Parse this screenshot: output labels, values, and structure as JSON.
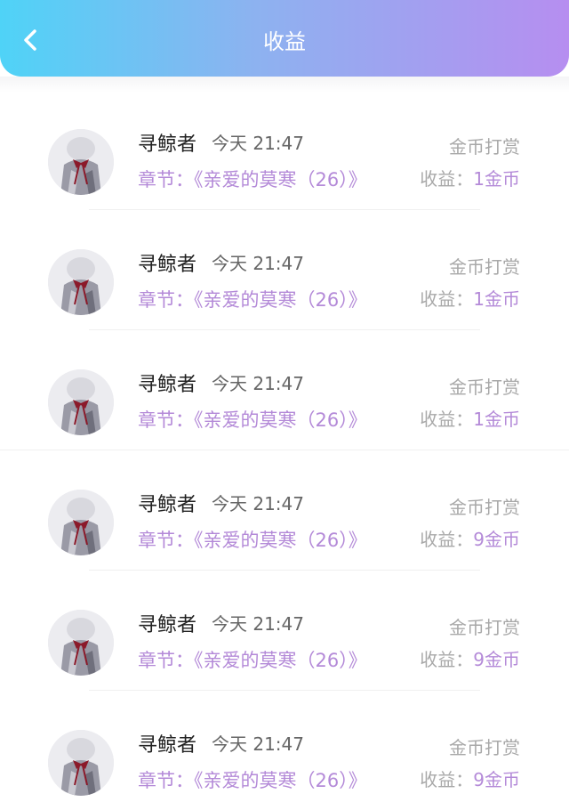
{
  "header": {
    "title": "收益",
    "back_icon": "chevron-left-icon"
  },
  "colors": {
    "accent": "#b48ad8",
    "gradient_start": "#4fd3f7",
    "gradient_end": "#b68ef0"
  },
  "rows": [
    {
      "name": "寻鲸者",
      "time": "今天 21:47",
      "chapter": "章节：《亲爱的莫寒（26）》",
      "type": "金币打赏",
      "earn_label": "收益：",
      "earn_value": "1金币"
    },
    {
      "name": "寻鲸者",
      "time": "今天 21:47",
      "chapter": "章节：《亲爱的莫寒（26）》",
      "type": "金币打赏",
      "earn_label": "收益：",
      "earn_value": "1金币"
    },
    {
      "name": "寻鲸者",
      "time": "今天 21:47",
      "chapter": "章节：《亲爱的莫寒（26）》",
      "type": "金币打赏",
      "earn_label": "收益：",
      "earn_value": "1金币"
    },
    {
      "name": "寻鲸者",
      "time": "今天 21:47",
      "chapter": "章节：《亲爱的莫寒（26）》",
      "type": "金币打赏",
      "earn_label": "收益：",
      "earn_value": "9金币"
    },
    {
      "name": "寻鲸者",
      "time": "今天 21:47",
      "chapter": "章节：《亲爱的莫寒（26）》",
      "type": "金币打赏",
      "earn_label": "收益：",
      "earn_value": "9金币"
    },
    {
      "name": "寻鲸者",
      "time": "今天 21:47",
      "chapter": "章节：《亲爱的莫寒（26）》",
      "type": "金币打赏",
      "earn_label": "收益：",
      "earn_value": "9金币"
    }
  ]
}
